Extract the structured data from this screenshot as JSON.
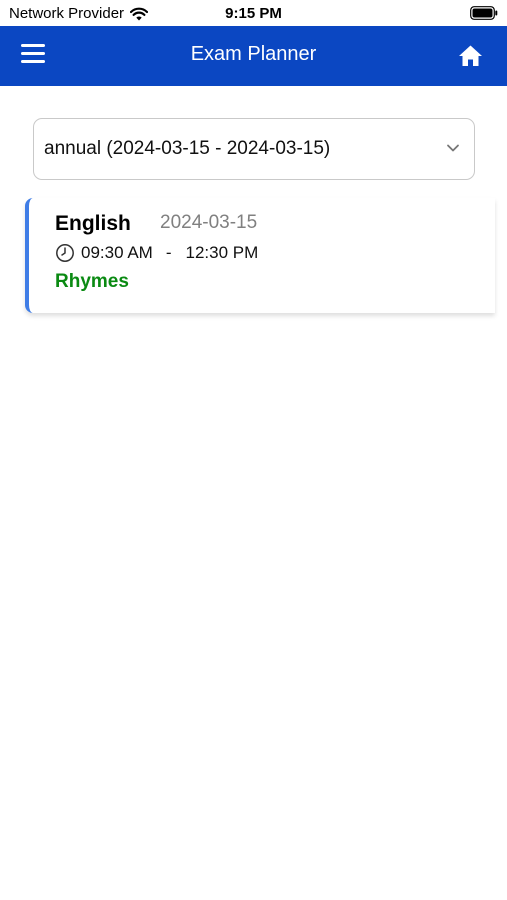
{
  "status_bar": {
    "carrier": "Network Provider",
    "time": "9:15 PM"
  },
  "app_bar": {
    "title": "Exam Planner",
    "background_color": "#0b47c2"
  },
  "exam_select": {
    "selected_value": "annual (2024-03-15 - 2024-03-15)"
  },
  "exams": [
    {
      "subject": "English",
      "date": "2024-03-15",
      "start_time": "09:30 AM",
      "separator": "-",
      "end_time": "12:30 PM",
      "topic": "Rhymes",
      "topic_color": "#0a8a12",
      "accent_color": "#3f7de6"
    }
  ]
}
